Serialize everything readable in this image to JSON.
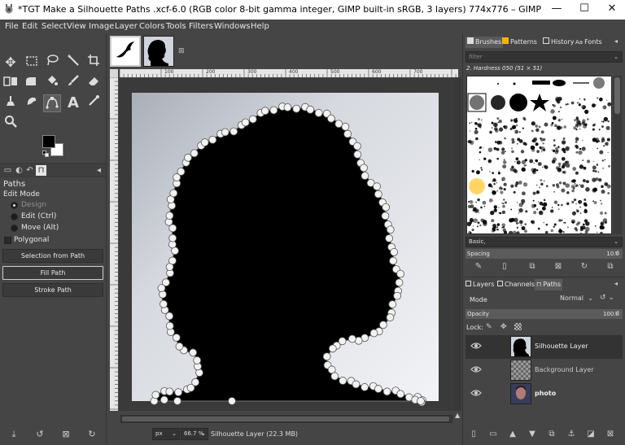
{
  "window": {
    "title": "*TGT Make a Silhouette Paths .xcf-6.0 (RGB color 8-bit gamma integer, GIMP built-in sRGB, 3 layers) 774x776 – GIMP",
    "minimize": "—",
    "maximize": "☐",
    "close": "✕"
  },
  "menubar": {
    "items": [
      "File",
      "Edit",
      "Select",
      "View",
      "Image",
      "Layer",
      "Colors",
      "Tools",
      "Filters",
      "Windows",
      "Help"
    ]
  },
  "toolbox": {
    "tools": [
      "move-tool",
      "rect-select-tool",
      "lasso-tool",
      "fuzzy-select-tool",
      "crop-tool",
      "unified-transform-tool",
      "warp-tool",
      "bucket-fill-tool",
      "paintbrush-tool",
      "eraser-tool",
      "clone-tool",
      "smudge-tool",
      "paths-tool",
      "text-tool",
      "color-picker-tool",
      "zoom-tool"
    ],
    "active_tool": "paths-tool"
  },
  "tool_options": {
    "title": "Paths",
    "edit_mode_label": "Edit Mode",
    "mode_design": "Design",
    "mode_edit": "Edit (Ctrl)",
    "mode_move": "Move (Alt)",
    "selected_mode": "Design",
    "polygonal_label": "Polygonal",
    "polygonal_checked": false,
    "btn_selection_from_path": "Selection from Path",
    "btn_fill_path": "Fill Path",
    "btn_stroke_path": "Stroke Path"
  },
  "colors": {
    "foreground": "#000000",
    "background": "#ffffff",
    "panel_bg": "#454545",
    "accent_gold": "#ffb300"
  },
  "image_tabs": {
    "items": [
      "bird-silhouette",
      "head-silhouette"
    ],
    "close_icon": "⊠"
  },
  "ruler": {
    "ticks": [
      "100",
      "200",
      "300",
      "400",
      "500",
      "600",
      "700"
    ]
  },
  "status": {
    "unit": "px",
    "zoom": "66.7 %",
    "layer_info": "Silhouette Layer (22.3 MB)"
  },
  "right_tabs": {
    "brushes": "Brushes",
    "patterns": "Patterns",
    "history": "History",
    "fonts": "Fonts",
    "filter_placeholder": "filter",
    "brush_name": "2. Hardness 050 (51 × 51)",
    "preset": "Basic,",
    "spacing_label": "Spacing",
    "spacing_value": "10.0"
  },
  "layers_panel": {
    "tab_layers": "Layers",
    "tab_channels": "Channels",
    "tab_paths": "Paths",
    "mode_label": "Mode",
    "mode_value": "Normal",
    "opacity_label": "Opacity",
    "opacity_value": "100.0",
    "lock_label": "Lock:",
    "layers": [
      {
        "name": "Silhouette Layer",
        "selected": true
      },
      {
        "name": "Background Layer",
        "selected": false
      },
      {
        "name": "photo",
        "selected": false
      }
    ]
  }
}
